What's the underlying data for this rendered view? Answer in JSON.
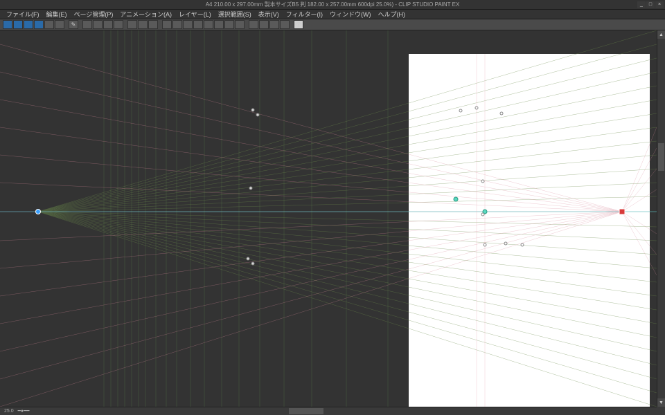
{
  "title": "A4 210.00 x 297.00mm 製本サイズB5 判 182.00 x 257.00mm 600dpi 25.0%) - CLIP STUDIO PAINT EX",
  "winbtns": {
    "min": "_",
    "max": "□",
    "close": "×"
  },
  "menu": {
    "file": "ファイル(F)",
    "edit": "編集(E)",
    "page": "ページ管理(P)",
    "anim": "アニメーション(A)",
    "layer": "レイヤー(L)",
    "select": "選択範囲(S)",
    "view": "表示(V)",
    "filter": "フィルター(I)",
    "window": "ウィンドウ(W)",
    "help": "ヘルプ(H)"
  },
  "status": {
    "zoom": "25.0"
  },
  "toolbar_icons": [
    "new",
    "open",
    "save",
    "save-all",
    "undo",
    "redo",
    "clear",
    "del",
    "|",
    "cut",
    "copy",
    "paste",
    "|",
    "scale",
    "rot",
    "flip",
    "|",
    "snap1",
    "snap2",
    "snap3",
    "snap4",
    "snap5",
    "snap6",
    "snap7",
    "snap8",
    "|",
    "grid1",
    "grid2",
    "grid3",
    "grid4",
    "|",
    "view"
  ]
}
